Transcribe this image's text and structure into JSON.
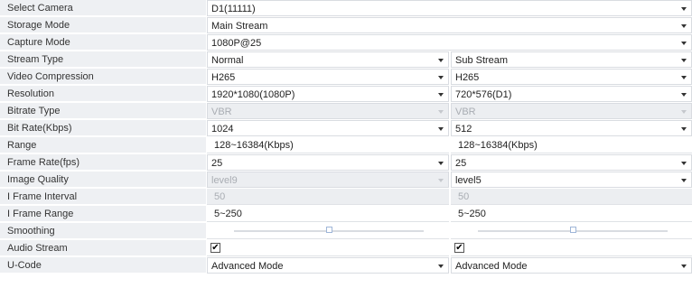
{
  "rows": {
    "select_camera": {
      "label": "Select Camera",
      "value": "D1(11111)"
    },
    "storage_mode": {
      "label": "Storage Mode",
      "value": "Main Stream"
    },
    "capture_mode": {
      "label": "Capture Mode",
      "value": "1080P@25"
    },
    "stream_type": {
      "label": "Stream Type",
      "main": "Normal",
      "sub": "Sub Stream"
    },
    "video_compression": {
      "label": "Video Compression",
      "main": "H265",
      "sub": "H265"
    },
    "resolution": {
      "label": "Resolution",
      "main": "1920*1080(1080P)",
      "sub": "720*576(D1)"
    },
    "bitrate_type": {
      "label": "Bitrate Type",
      "main": "VBR",
      "sub": "VBR"
    },
    "bit_rate": {
      "label": "Bit Rate(Kbps)",
      "main": "1024",
      "sub": "512"
    },
    "range": {
      "label": "Range",
      "main": "128~16384(Kbps)",
      "sub": "128~16384(Kbps)"
    },
    "frame_rate": {
      "label": "Frame Rate(fps)",
      "main": "25",
      "sub": "25"
    },
    "image_quality": {
      "label": "Image Quality",
      "main": "level9",
      "sub": "level5"
    },
    "i_frame_interval": {
      "label": "I Frame Interval",
      "main": "50",
      "sub": "50"
    },
    "i_frame_range": {
      "label": "I Frame Range",
      "main": "5~250",
      "sub": "5~250"
    },
    "smoothing": {
      "label": "Smoothing",
      "main_level": 0.5,
      "sub_level": 0.5
    },
    "audio_stream": {
      "label": "Audio Stream",
      "main_checked": true,
      "sub_checked": true,
      "check_glyph": "✔"
    },
    "u_code": {
      "label": "U-Code",
      "main": "Advanced Mode",
      "sub": "Advanced Mode"
    }
  },
  "colors": {
    "label_bg": "#eef0f3",
    "disabled_bg": "#eceef1",
    "slider_knob_border": "#9fb6d8"
  }
}
